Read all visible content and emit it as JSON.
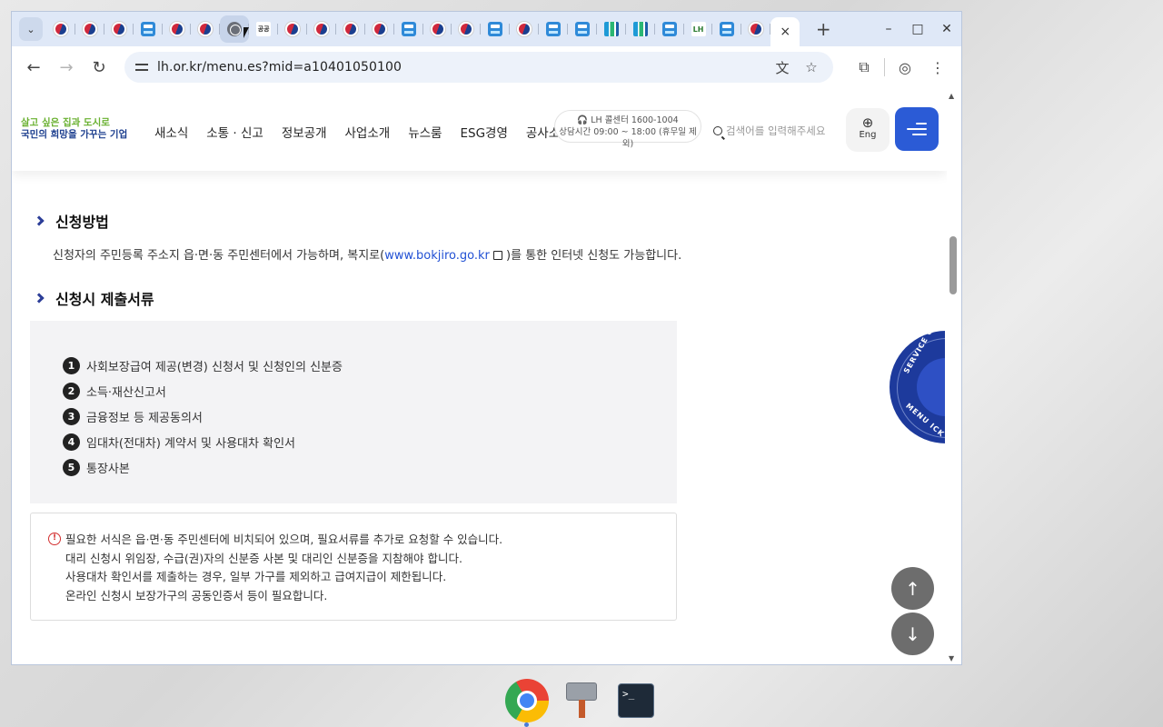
{
  "browser": {
    "tab_search_icon": "chevron-down-icon",
    "tabs": [
      {
        "icon": "korea-gov-icon"
      },
      {
        "icon": "korea-gov-icon"
      },
      {
        "icon": "korea-gov-icon"
      },
      {
        "icon": "lh-icon"
      },
      {
        "icon": "korea-gov-icon"
      },
      {
        "icon": "korea-gov-icon"
      },
      {
        "icon": "globe-icon"
      },
      {
        "icon": "text-favicon",
        "label": "공공"
      },
      {
        "icon": "korea-gov-icon"
      },
      {
        "icon": "korea-gov-icon"
      },
      {
        "icon": "korea-gov-icon"
      },
      {
        "icon": "korea-gov-icon"
      },
      {
        "icon": "lh-icon"
      },
      {
        "icon": "korea-gov-icon"
      },
      {
        "icon": "korea-gov-icon"
      },
      {
        "icon": "lh-icon"
      },
      {
        "icon": "korea-gov-icon"
      },
      {
        "icon": "lh-icon"
      },
      {
        "icon": "lh-icon"
      },
      {
        "icon": "building-icon"
      },
      {
        "icon": "building-icon"
      },
      {
        "icon": "lh-icon"
      },
      {
        "icon": "lh-green-icon",
        "label": "LH"
      },
      {
        "icon": "lh-icon"
      },
      {
        "icon": "korea-gov-icon"
      }
    ],
    "active_tab_close": "×",
    "new_tab": "+",
    "window_controls": {
      "minimize": "–",
      "maximize": "□",
      "close": "✕"
    },
    "nav": {
      "back": "←",
      "forward": "→",
      "reload": "↻"
    },
    "url": "lh.or.kr/menu.es?mid=a10401050100",
    "omnibox_icons": {
      "translate": "文",
      "bookmark": "☆"
    },
    "toolbar_icons": {
      "extensions": "⧉",
      "profile": "◎",
      "menu": "⋮"
    }
  },
  "site": {
    "logo": {
      "line1": "살고 싶은 집과 도시로",
      "line2": "국민의 희망을 가꾸는 기업"
    },
    "gnb": [
      "새소식",
      "소통 · 신고",
      "정보공개",
      "사업소개",
      "뉴스룸",
      "ESG경영",
      "공사소개"
    ],
    "callcenter": {
      "line1": "LH 콜센터 1600-1004",
      "line2": "상담시간 09:00 ~ 18:00 (휴무일 제외)"
    },
    "search_placeholder": "검색어를 입력해주세요",
    "eng_label": "Eng"
  },
  "content": {
    "section1": {
      "title": "신청방법",
      "text_before": "신청자의 주민등록 주소지 읍·면·동 주민센터에서 가능하며, 복지로(",
      "link": "www.bokjiro.go.kr",
      "text_after": ")를 통한 인터넷 신청도 가능합니다."
    },
    "section2": {
      "title": "신청시 제출서류",
      "documents": [
        {
          "num": "1",
          "text": "사회보장급여 제공(변경) 신청서 및 신청인의 신분증"
        },
        {
          "num": "2",
          "text": "소득·재산신고서"
        },
        {
          "num": "3",
          "text": "금융정보 등 제공동의서"
        },
        {
          "num": "4",
          "text": "임대차(전대차) 계약서 및 사용대차 확인서"
        },
        {
          "num": "5",
          "text": "통장사본"
        }
      ]
    },
    "notice": {
      "icon": "!",
      "lines": [
        "필요한 서식은 읍·면·동 주민센터에 비치되어 있으며, 필요서류를 추가로 요청할 수 있습니다.",
        "대리 신청시 위임장, 수급(권)자의 신분증 사본 및 대리인 신분증을 지참해야 합니다.",
        "사용대차 확인서를 제출하는 경우, 일부 가구를 제외하고 급여지급이 제한됩니다.",
        "온라인 신청시 보장가구의 공동인증서 등이 필요합니다."
      ]
    },
    "quick_menu": {
      "text_top": "SERVICE QU",
      "text_bottom": "MENU ICK"
    },
    "scroll_top": "↑",
    "scroll_bottom": "↓"
  },
  "shelf": {
    "apps": [
      {
        "name": "chrome",
        "label": ""
      },
      {
        "name": "tool",
        "label": ""
      },
      {
        "name": "terminal",
        "label": ">_"
      }
    ]
  }
}
